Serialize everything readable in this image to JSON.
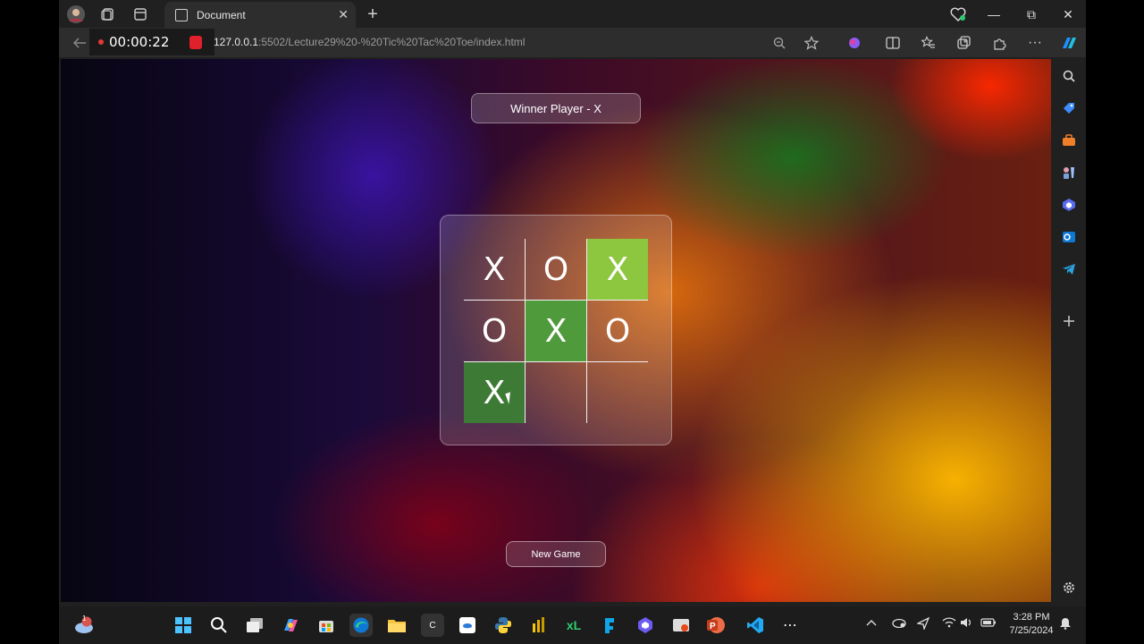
{
  "browser": {
    "tab": {
      "title": "Document",
      "close_glyph": "✕"
    },
    "new_tab_glyph": "+",
    "window_controls": {
      "minimize": "—",
      "restore": "⧉",
      "close": "✕"
    },
    "url_host": "127.0.0.1",
    "url_path": ":5502/Lecture29%20-%20Tic%20Tac%20Toe/index.html"
  },
  "recorder": {
    "time": "00:00:22"
  },
  "game": {
    "winner_text": "Winner Player - X",
    "new_game_label": "New Game",
    "board": [
      "X",
      "O",
      "X",
      "O",
      "X",
      "O",
      "X",
      "",
      ""
    ],
    "winning_cells": [
      2,
      4,
      6
    ]
  },
  "taskbar": {
    "clock_time": "3:28 PM",
    "clock_date": "7/25/2024",
    "weather_badge": "1",
    "overflow_glyph": "⋯"
  },
  "icons": {
    "tabstrip": [
      "profile-avatar-icon",
      "workspaces-icon",
      "tab-actions-icon"
    ],
    "address": [
      "back-icon",
      "zoom-icon",
      "favorite-star-icon",
      "copilot-icon",
      "split-screen-icon",
      "favorites-icon",
      "collections-icon",
      "extensions-icon",
      "more-icon"
    ],
    "sidebar": [
      "search-icon",
      "tag-icon",
      "tools-icon",
      "games-icon",
      "copilot-app-icon",
      "outlook-icon",
      "telegram-icon",
      "add-icon",
      "settings-icon"
    ]
  },
  "colors": {
    "win_cell_1": "#8dc63f",
    "win_cell_2": "#4f9a3a",
    "win_cell_3": "#3d7a35"
  }
}
